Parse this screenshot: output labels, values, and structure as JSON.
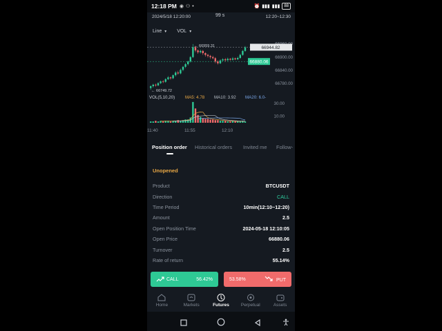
{
  "status_bar": {
    "time": "12:18 PM",
    "battery": "88"
  },
  "chart_header": {
    "datetime": "2024/5/18 12:20:00",
    "countdown": "99 s",
    "period": "12:20~12:30"
  },
  "selectors": {
    "type": "Line",
    "indicator": "VOL"
  },
  "chart_data": {
    "type": "candlestick",
    "price_axis": [
      "66960.00",
      "66900.00",
      "66840.00",
      "66780.00"
    ],
    "time_axis": [
      "11:40",
      "11:55",
      "12:10"
    ],
    "high_label": "66959.31",
    "low_label": "66749.72",
    "current_price": "66944.82",
    "open_price_line": "66880.06",
    "candles": [
      {
        "o": 66760,
        "c": 66768,
        "h": 66772,
        "l": 66752
      },
      {
        "o": 66768,
        "c": 66775,
        "h": 66779,
        "l": 66762
      },
      {
        "o": 66775,
        "c": 66772,
        "h": 66780,
        "l": 66766
      },
      {
        "o": 66772,
        "c": 66782,
        "h": 66786,
        "l": 66768
      },
      {
        "o": 66782,
        "c": 66790,
        "h": 66794,
        "l": 66778
      },
      {
        "o": 66790,
        "c": 66788,
        "h": 66796,
        "l": 66782
      },
      {
        "o": 66788,
        "c": 66800,
        "h": 66804,
        "l": 66784
      },
      {
        "o": 66800,
        "c": 66808,
        "h": 66814,
        "l": 66796
      },
      {
        "o": 66808,
        "c": 66804,
        "h": 66812,
        "l": 66798
      },
      {
        "o": 66804,
        "c": 66818,
        "h": 66822,
        "l": 66800
      },
      {
        "o": 66818,
        "c": 66830,
        "h": 66836,
        "l": 66812
      },
      {
        "o": 66830,
        "c": 66826,
        "h": 66838,
        "l": 66820
      },
      {
        "o": 66826,
        "c": 66842,
        "h": 66848,
        "l": 66822
      },
      {
        "o": 66842,
        "c": 66856,
        "h": 66860,
        "l": 66836
      },
      {
        "o": 66856,
        "c": 66868,
        "h": 66874,
        "l": 66850
      },
      {
        "o": 66868,
        "c": 66880,
        "h": 66884,
        "l": 66862
      },
      {
        "o": 66880,
        "c": 66900,
        "h": 66905,
        "l": 66875
      },
      {
        "o": 66900,
        "c": 66945,
        "h": 66959,
        "l": 66896
      },
      {
        "o": 66945,
        "c": 66930,
        "h": 66950,
        "l": 66922
      },
      {
        "o": 66930,
        "c": 66922,
        "h": 66935,
        "l": 66915
      },
      {
        "o": 66922,
        "c": 66928,
        "h": 66934,
        "l": 66916
      },
      {
        "o": 66928,
        "c": 66918,
        "h": 66932,
        "l": 66910
      },
      {
        "o": 66918,
        "c": 66910,
        "h": 66922,
        "l": 66902
      },
      {
        "o": 66910,
        "c": 66905,
        "h": 66915,
        "l": 66898
      },
      {
        "o": 66905,
        "c": 66900,
        "h": 66910,
        "l": 66892
      },
      {
        "o": 66900,
        "c": 66895,
        "h": 66906,
        "l": 66890
      },
      {
        "o": 66895,
        "c": 66880,
        "h": 66900,
        "l": 66872
      },
      {
        "o": 66880,
        "c": 66872,
        "h": 66886,
        "l": 66866
      },
      {
        "o": 66872,
        "c": 66885,
        "h": 66890,
        "l": 66868
      },
      {
        "o": 66885,
        "c": 66890,
        "h": 66895,
        "l": 66880
      },
      {
        "o": 66890,
        "c": 66886,
        "h": 66896,
        "l": 66880
      },
      {
        "o": 66886,
        "c": 66892,
        "h": 66898,
        "l": 66882
      },
      {
        "o": 66892,
        "c": 66888,
        "h": 66896,
        "l": 66884
      },
      {
        "o": 66888,
        "c": 66894,
        "h": 66900,
        "l": 66884
      },
      {
        "o": 66894,
        "c": 66890,
        "h": 66898,
        "l": 66886
      },
      {
        "o": 66890,
        "c": 66896,
        "h": 66902,
        "l": 66886
      },
      {
        "o": 66896,
        "c": 66910,
        "h": 66915,
        "l": 66892
      },
      {
        "o": 66910,
        "c": 66928,
        "h": 66932,
        "l": 66906
      },
      {
        "o": 66928,
        "c": 66944,
        "h": 66950,
        "l": 66924
      }
    ],
    "volume_legend": {
      "label": "VOL(5,10,20)",
      "ma5": "MA5: 4.78",
      "ma10": "MA10: 3.92",
      "ma20": "MA20: 6.0-"
    },
    "volume_axis": [
      "30.00",
      "10.00"
    ],
    "volumes": [
      2,
      2,
      3,
      2,
      3,
      2,
      3,
      3,
      2,
      3,
      3,
      4,
      3,
      4,
      5,
      5,
      8,
      32,
      22,
      12,
      9,
      7,
      6,
      6,
      5,
      5,
      4,
      4,
      3,
      3,
      3,
      2,
      2,
      3,
      2,
      2,
      2,
      3,
      2
    ]
  },
  "tabs": [
    "Position order",
    "Historical orders",
    "Invited me",
    "Follow-"
  ],
  "order_status": "Unopened",
  "details": [
    {
      "label": "Product",
      "value": "BTCUSDT"
    },
    {
      "label": "Direction",
      "value": "CALL"
    },
    {
      "label": "Time Period",
      "value": "10min(12:10~12:20)"
    },
    {
      "label": "Amount",
      "value": "2.5"
    },
    {
      "label": "Open Position Time",
      "value": "2024-05-18 12:10:05"
    },
    {
      "label": "Open Price",
      "value": "66880.06"
    },
    {
      "label": "Turnover",
      "value": "2.5"
    },
    {
      "label": "Rate of return",
      "value": "55.14%"
    }
  ],
  "actions": {
    "call": {
      "label": "CALL",
      "percent": "56.42%"
    },
    "put": {
      "label": "PUT",
      "percent": "53.58%"
    }
  },
  "nav": [
    {
      "label": "Home"
    },
    {
      "label": "Markets"
    },
    {
      "label": "Futures"
    },
    {
      "label": "Perpetual"
    },
    {
      "label": "Assets"
    }
  ],
  "colors": {
    "up": "#2ec995",
    "down": "#f06b6b",
    "accent": "#e9a845",
    "background": "#151a21"
  }
}
